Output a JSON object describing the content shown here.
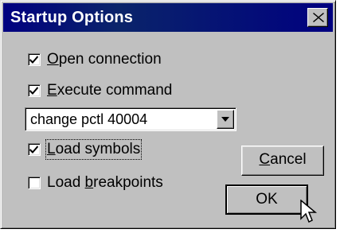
{
  "dialog": {
    "title": "Startup Options"
  },
  "options": [
    {
      "before": "",
      "mnemonic": "O",
      "after": "pen connection",
      "checked": true
    },
    {
      "before": "",
      "mnemonic": "E",
      "after": "xecute command",
      "checked": true
    },
    {
      "before": "",
      "mnemonic": "L",
      "after": "oad symbols",
      "checked": true
    },
    {
      "before": "Load ",
      "mnemonic": "b",
      "after": "reakpoints",
      "checked": false
    }
  ],
  "command_combo": {
    "value": "change pctl 40004"
  },
  "buttons": {
    "cancel": {
      "mnemonic": "C",
      "rest": "ancel"
    },
    "ok": "OK"
  },
  "icons": {
    "close": "close-icon",
    "dropdown": "chevron-down-icon",
    "check": "check-icon",
    "pointer": "mouse-pointer-icon"
  }
}
